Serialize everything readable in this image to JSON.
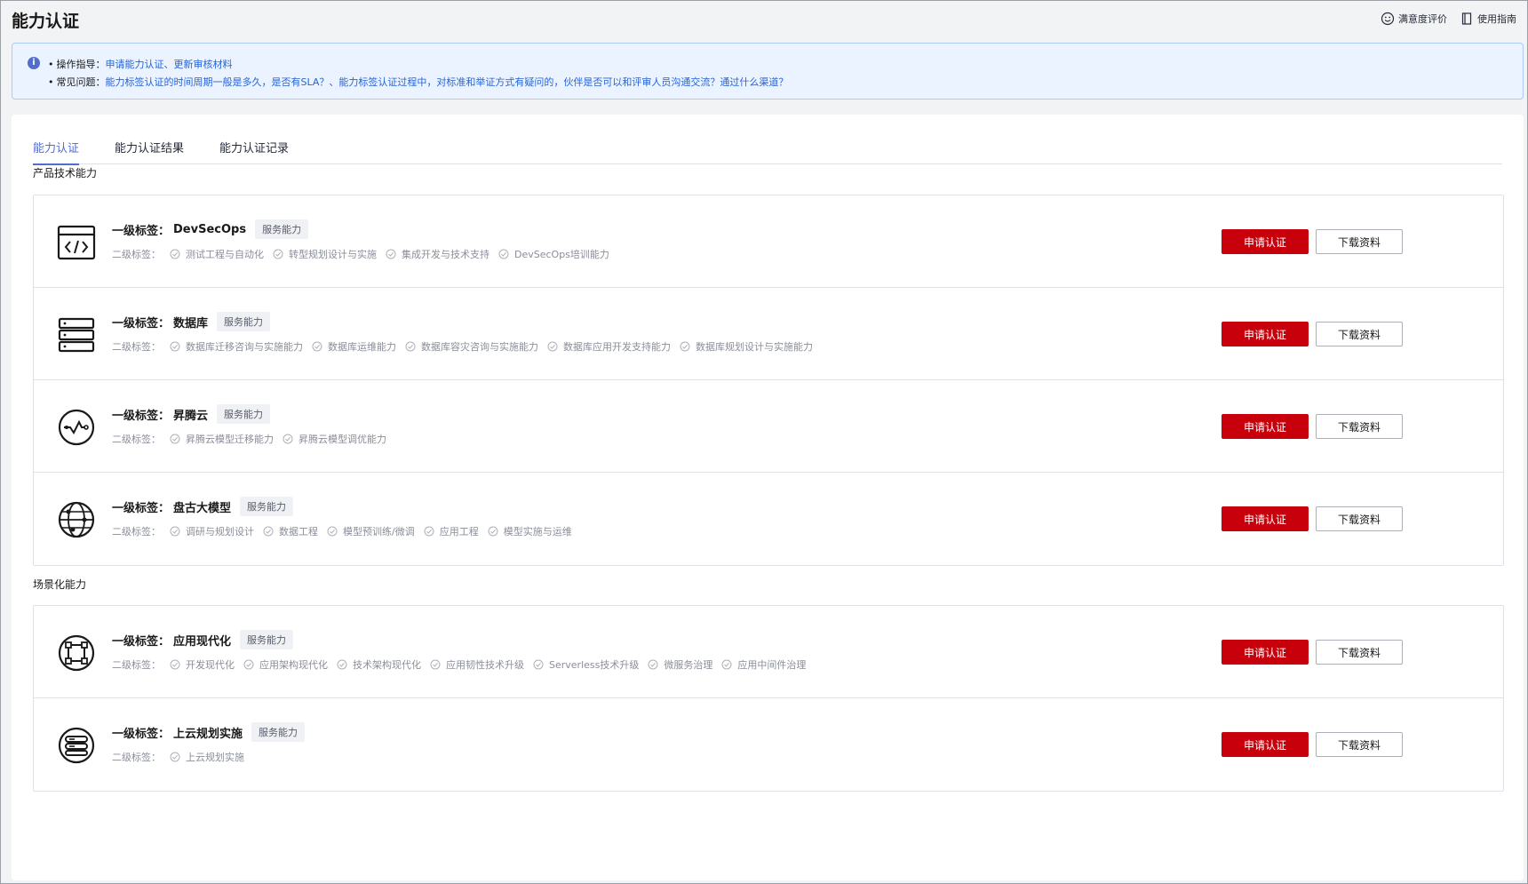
{
  "page_title": "能力认证",
  "top_links": [
    {
      "label": "满意度评价",
      "icon": "smile-icon"
    },
    {
      "label": "使用指南",
      "icon": "book-icon"
    }
  ],
  "notice": {
    "row1": {
      "bullet": "•",
      "key": "操作指导：",
      "links": [
        "申请能力认证",
        "更新审核材料"
      ],
      "sep": "、"
    },
    "row2": {
      "bullet": "•",
      "key": "常见问题：",
      "links": [
        "能力标签认证的时间周期一般是多久，是否有SLA？",
        "能力标签认证过程中，对标准和举证方式有疑问的，伙伴是否可以和评审人员沟通交流？通过什么渠道？"
      ],
      "sep": "、"
    }
  },
  "tabs": [
    "能力认证",
    "能力认证结果",
    "能力认证记录"
  ],
  "labels": {
    "level1": "一级标签：",
    "level2": "二级标签：",
    "badge": "服务能力",
    "apply": "申请认证",
    "download": "下载资料"
  },
  "sections": [
    {
      "title": "产品技术能力",
      "cards": [
        {
          "icon": "code-window-icon",
          "name": "DevSecOps",
          "tags": [
            "测试工程与自动化",
            "转型规划设计与实施",
            "集成开发与技术支持",
            "DevSecOps培训能力"
          ]
        },
        {
          "icon": "database-icon",
          "name": "数据库",
          "tags": [
            "数据库迁移咨询与实施能力",
            "数据库运维能力",
            "数据库容灾咨询与实施能力",
            "数据库应用开发支持能力",
            "数据库规划设计与实施能力"
          ]
        },
        {
          "icon": "pulse-circle-icon",
          "name": "昇腾云",
          "tags": [
            "昇腾云模型迁移能力",
            "昇腾云模型调优能力"
          ]
        },
        {
          "icon": "globe-network-icon",
          "name": "盘古大模型",
          "tags": [
            "调研与规划设计",
            "数据工程",
            "模型预训练/微调",
            "应用工程",
            "模型实施与运维"
          ]
        }
      ]
    },
    {
      "title": "场景化能力",
      "cards": [
        {
          "icon": "modernize-circle-icon",
          "name": "应用现代化",
          "tags": [
            "开发现代化",
            "应用架构现代化",
            "技术架构现代化",
            "应用韧性技术升级",
            "Serverless技术升级",
            "微服务治理",
            "应用中间件治理"
          ]
        },
        {
          "icon": "cloud-server-circle-icon",
          "name": "上云规划实施",
          "tags": [
            "上云规划实施"
          ]
        }
      ]
    }
  ]
}
